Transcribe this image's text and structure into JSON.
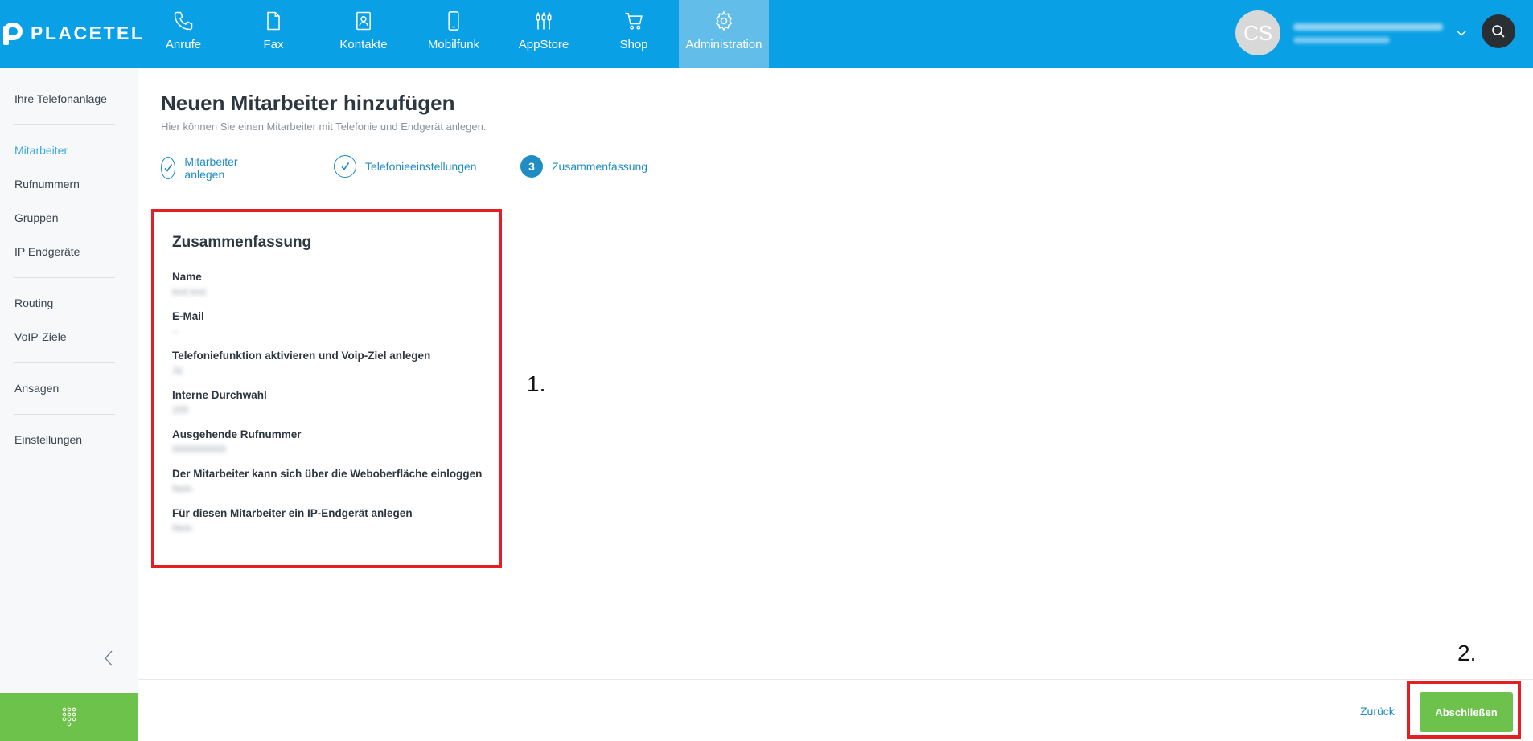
{
  "brand": {
    "logo_text": "PLACETEL"
  },
  "nav": {
    "items": [
      {
        "label": "Anrufe",
        "icon": "phone-icon"
      },
      {
        "label": "Fax",
        "icon": "document-icon"
      },
      {
        "label": "Kontakte",
        "icon": "contacts-icon"
      },
      {
        "label": "Mobilfunk",
        "icon": "mobile-icon"
      },
      {
        "label": "AppStore",
        "icon": "plugs-icon"
      },
      {
        "label": "Shop",
        "icon": "cart-icon"
      },
      {
        "label": "Administration",
        "icon": "gear-icon",
        "active": true
      }
    ]
  },
  "user": {
    "initials": "CS"
  },
  "sidebar": {
    "items": [
      {
        "label": "Ihre Telefonanlage"
      },
      {
        "label": "Mitarbeiter",
        "active": true
      },
      {
        "label": "Rufnummern"
      },
      {
        "label": "Gruppen"
      },
      {
        "label": "IP Endgeräte"
      },
      {
        "label": "Routing"
      },
      {
        "label": "VoIP-Ziele"
      },
      {
        "label": "Ansagen"
      },
      {
        "label": "Einstellungen"
      }
    ]
  },
  "page": {
    "title": "Neuen Mitarbeiter hinzufügen",
    "subtitle": "Hier können Sie einen Mitarbeiter mit Telefonie und Endgerät anlegen."
  },
  "steps": [
    {
      "label": "Mitarbeiter anlegen",
      "state": "done"
    },
    {
      "label": "Telefonieeinstellungen",
      "state": "done"
    },
    {
      "label": "Zusammenfassung",
      "state": "current",
      "number": "3"
    }
  ],
  "summary": {
    "title": "Zusammenfassung",
    "fields": [
      {
        "label": "Name",
        "value": "test test"
      },
      {
        "label": "E-Mail",
        "value": "--"
      },
      {
        "label": "Telefoniefunktion aktivieren und Voip-Ziel anlegen",
        "value": "Ja"
      },
      {
        "label": "Interne Durchwahl",
        "value": "100"
      },
      {
        "label": "Ausgehende Rufnummer",
        "value": "0000000000"
      },
      {
        "label": "Der Mitarbeiter kann sich über die Weboberfläche einloggen",
        "value": "Nein"
      },
      {
        "label": "Für diesen Mitarbeiter ein IP-Endgerät anlegen",
        "value": "Nein"
      }
    ]
  },
  "annotations": {
    "first": "1.",
    "second": "2."
  },
  "footer": {
    "back_label": "Zurück",
    "finish_label": "Abschließen"
  },
  "colors": {
    "brand": "#0aa0e6",
    "nav_active": "#63bde9",
    "link": "#1f8cc4",
    "success": "#6cc24a",
    "highlight": "#e31e24"
  }
}
